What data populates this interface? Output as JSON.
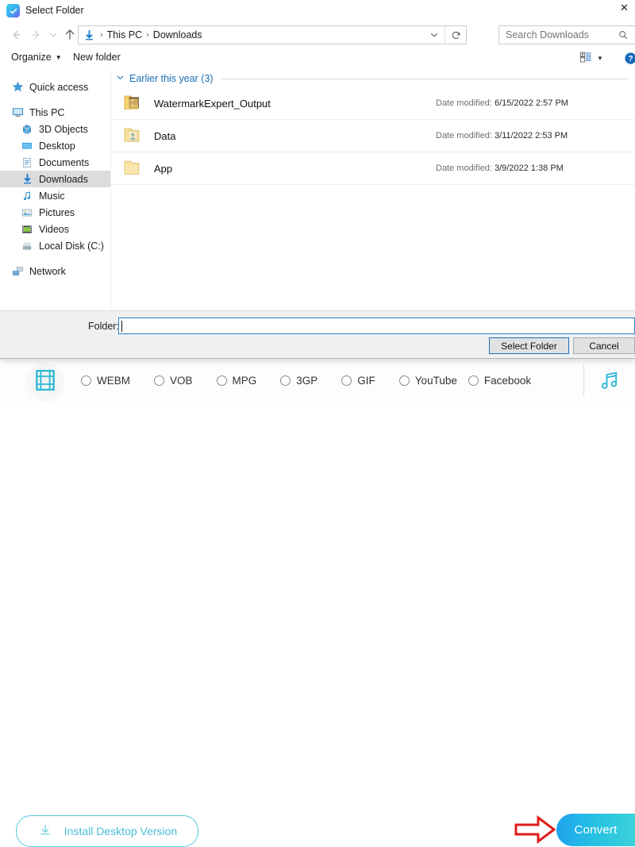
{
  "dialog": {
    "title": "Select Folder",
    "title_icon": "app-check-icon",
    "close_label": "✕",
    "nav": {
      "back_icon": "arrow-left-icon",
      "forward_icon": "arrow-right-icon",
      "recent_icon": "chevron-down-icon",
      "up_icon": "arrow-up-icon",
      "breadcrumb": [
        "This PC",
        "Downloads"
      ],
      "breadcrumb_icon": "downloads-icon",
      "separator": "›",
      "refresh_icon": "refresh-icon",
      "dropdown_icon": "chevron-down-icon"
    },
    "search": {
      "placeholder": "Search Downloads",
      "icon": "search-icon"
    },
    "toolbar": {
      "organize": "Organize",
      "organize_caret": "▼",
      "new_folder": "New folder",
      "view_icon": "view-layout-icon",
      "view_caret": "▼",
      "help_icon": "help-icon"
    },
    "sidebar": {
      "items": [
        {
          "label": "Quick access",
          "icon": "star-icon",
          "indent": false,
          "selected": false
        },
        {
          "label": "This PC",
          "icon": "monitor-icon",
          "indent": false,
          "selected": false
        },
        {
          "label": "3D Objects",
          "icon": "cube-icon",
          "indent": true,
          "selected": false
        },
        {
          "label": "Desktop",
          "icon": "desktop-icon",
          "indent": true,
          "selected": false
        },
        {
          "label": "Documents",
          "icon": "documents-icon",
          "indent": true,
          "selected": false
        },
        {
          "label": "Downloads",
          "icon": "downloads-icon",
          "indent": true,
          "selected": true
        },
        {
          "label": "Music",
          "icon": "music-icon",
          "indent": true,
          "selected": false
        },
        {
          "label": "Pictures",
          "icon": "pictures-icon",
          "indent": true,
          "selected": false
        },
        {
          "label": "Videos",
          "icon": "videos-icon",
          "indent": true,
          "selected": false
        },
        {
          "label": "Local Disk (C:)",
          "icon": "disk-icon",
          "indent": true,
          "selected": false
        },
        {
          "label": "Network",
          "icon": "network-icon",
          "indent": false,
          "selected": false
        }
      ]
    },
    "filelist": {
      "group_label": "Earlier this year (3)",
      "group_chevron": "⌄",
      "date_prefix": "Date modified:",
      "rows": [
        {
          "name": "WatermarkExpert_Output",
          "date": "6/15/2022 2:57 PM",
          "icon": "folder-thumbnail-icon"
        },
        {
          "name": "Data",
          "date": "3/11/2022 2:53 PM",
          "icon": "folder-thumbnail-icon"
        },
        {
          "name": "App",
          "date": "3/9/2022 1:38 PM",
          "icon": "folder-icon"
        }
      ]
    },
    "footer": {
      "folder_label": "Folder:",
      "folder_value": "",
      "select_button": "Select Folder",
      "cancel_button": "Cancel"
    }
  },
  "page": {
    "film_icon": "film-strip-icon",
    "music_icon": "music-note-icon",
    "formats": [
      {
        "label": "WEBM",
        "selected": false
      },
      {
        "label": "VOB",
        "selected": false
      },
      {
        "label": "MPG",
        "selected": false
      },
      {
        "label": "3GP",
        "selected": false
      },
      {
        "label": "GIF",
        "selected": false
      },
      {
        "label": "YouTube",
        "selected": false
      },
      {
        "label": "Facebook",
        "selected": false
      }
    ],
    "install_button": "Install Desktop Version",
    "install_icon": "download-icon",
    "convert_button": "Convert",
    "arrow_annotation": "red-right-arrow-icon",
    "colors": {
      "accent_cyan": "#49bfd6",
      "convert_gradient_start": "#1ea4ee",
      "convert_gradient_end": "#3ad2d8",
      "arrow_red": "#e01b1b",
      "selected_sidebar": "#dcdcdc",
      "focus_blue": "#1c6ebf"
    }
  }
}
